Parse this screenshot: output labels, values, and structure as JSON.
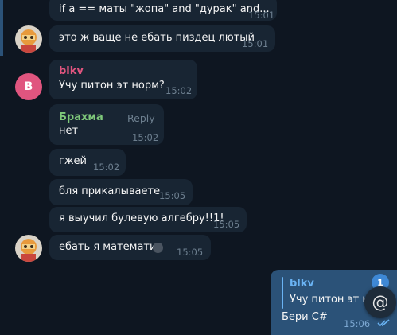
{
  "messages": [
    {
      "text": "if a == маты \"жопа\" and \"дурак\" and...",
      "time": "15:01"
    },
    {
      "text": "это ж ваще не ебать пиздец лютый",
      "time": "15:01"
    },
    {
      "sender": "blkv",
      "text": "Учу питон эт норм?",
      "time": "15:02"
    },
    {
      "sender": "Брахма",
      "reply": "Reply",
      "text": "нет",
      "time": "15:02"
    },
    {
      "text": "гжей",
      "time": "15:02"
    },
    {
      "text": "бля прикалываете",
      "time": "15:05"
    },
    {
      "text": "я выучил булевую алгебру!!1!",
      "time": "15:05"
    },
    {
      "text": "ебать я математик",
      "time": "15:05"
    }
  ],
  "avatar_b_letter": "B",
  "outgoing": {
    "quote_name": "blkv",
    "quote_text": "Учу питон эт но",
    "text": "Бери C#",
    "time": "15:06",
    "status": "read"
  },
  "mentions_badge": "1",
  "mentions_symbol": "@",
  "colors": {
    "background": "#0e1621",
    "incoming_bubble": "#182533",
    "outgoing_bubble": "#2b5278",
    "blkv_name": "#e0557f",
    "brahma_name": "#7ec87a",
    "accent": "#3e88d5"
  }
}
